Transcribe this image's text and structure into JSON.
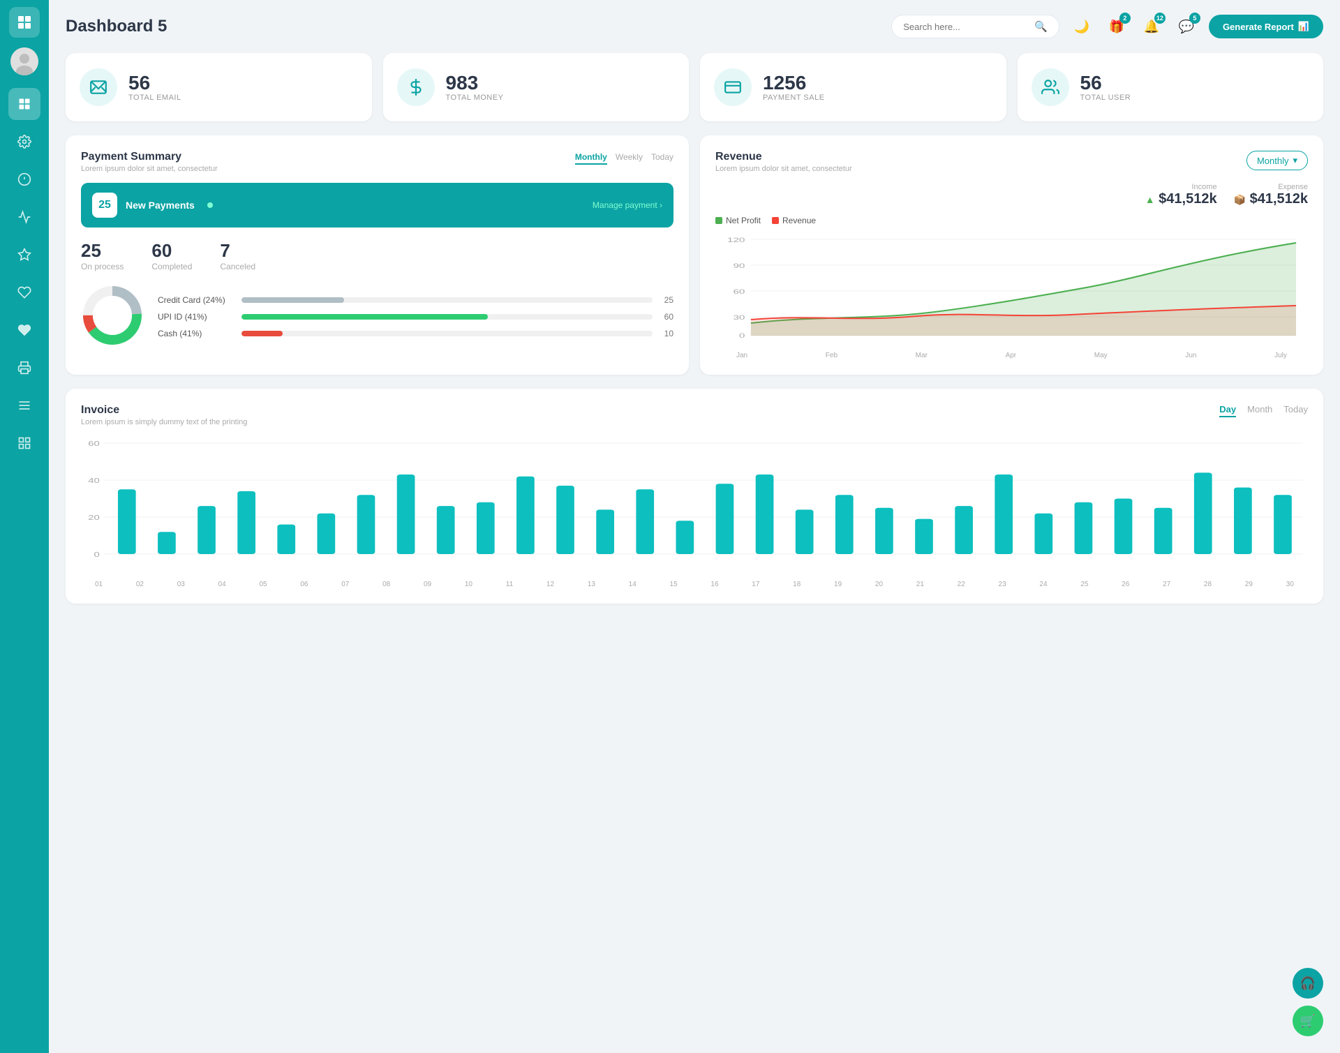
{
  "app": {
    "title": "Dashboard 5"
  },
  "header": {
    "search_placeholder": "Search here...",
    "generate_btn": "Generate Report",
    "badges": {
      "gift": "2",
      "bell": "12",
      "chat": "5"
    }
  },
  "stat_cards": [
    {
      "id": "email",
      "icon": "✉",
      "number": "56",
      "label": "TOTAL EMAIL"
    },
    {
      "id": "money",
      "icon": "$",
      "number": "983",
      "label": "TOTAL MONEY"
    },
    {
      "id": "payment",
      "icon": "💳",
      "number": "1256",
      "label": "PAYMENT SALE"
    },
    {
      "id": "user",
      "icon": "👥",
      "number": "56",
      "label": "TOTAL USER"
    }
  ],
  "payment_summary": {
    "title": "Payment Summary",
    "subtitle": "Lorem ipsum dolor sit amet, consectetur",
    "tabs": [
      "Monthly",
      "Weekly",
      "Today"
    ],
    "active_tab": "Monthly",
    "new_payments_count": "25",
    "new_payments_label": "New Payments",
    "manage_link": "Manage payment",
    "stats": [
      {
        "number": "25",
        "label": "On process"
      },
      {
        "number": "60",
        "label": "Completed"
      },
      {
        "number": "7",
        "label": "Canceled"
      }
    ],
    "progress_bars": [
      {
        "label": "Credit Card (24%)",
        "value": 25,
        "max": 100,
        "color": "#b0bec5",
        "display": "25"
      },
      {
        "label": "UPI ID (41%)",
        "value": 60,
        "max": 100,
        "color": "#2ecc71",
        "display": "60"
      },
      {
        "label": "Cash (41%)",
        "value": 10,
        "max": 100,
        "color": "#e74c3c",
        "display": "10"
      }
    ]
  },
  "revenue": {
    "title": "Revenue",
    "subtitle": "Lorem ipsum dolor sit amet, consectetur",
    "dropdown": "Monthly",
    "income": {
      "label": "Income",
      "value": "$41,512k"
    },
    "expense": {
      "label": "Expense",
      "value": "$41,512k"
    },
    "legend": [
      {
        "label": "Net Profit",
        "color": "#4caf50"
      },
      {
        "label": "Revenue",
        "color": "#f44336"
      }
    ],
    "x_labels": [
      "Jan",
      "Feb",
      "Mar",
      "Apr",
      "May",
      "Jun",
      "July"
    ],
    "y_labels": [
      "120",
      "90",
      "60",
      "30",
      "0"
    ]
  },
  "invoice": {
    "title": "Invoice",
    "subtitle": "Lorem ipsum is simply dummy text of the printing",
    "tabs": [
      "Day",
      "Month",
      "Today"
    ],
    "active_tab": "Day",
    "y_labels": [
      "60",
      "40",
      "20",
      "0"
    ],
    "x_labels": [
      "01",
      "02",
      "03",
      "04",
      "05",
      "06",
      "07",
      "08",
      "09",
      "10",
      "11",
      "12",
      "13",
      "14",
      "15",
      "16",
      "17",
      "18",
      "19",
      "20",
      "21",
      "22",
      "23",
      "24",
      "25",
      "26",
      "27",
      "28",
      "29",
      "30"
    ],
    "bars": [
      35,
      12,
      26,
      34,
      16,
      22,
      32,
      43,
      26,
      28,
      42,
      37,
      24,
      35,
      18,
      38,
      43,
      24,
      32,
      25,
      19,
      26,
      43,
      22,
      28,
      30,
      25,
      44,
      36,
      32
    ]
  }
}
